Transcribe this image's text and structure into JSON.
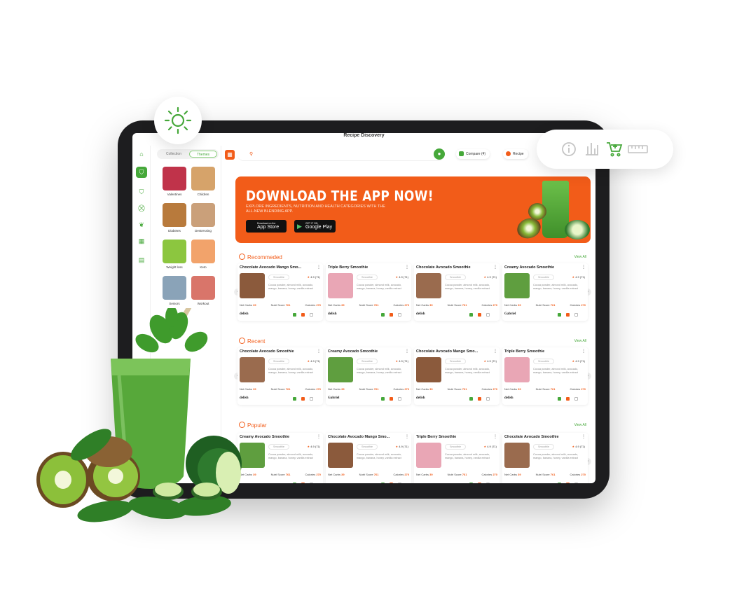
{
  "app": {
    "title": "Recipe Discovery"
  },
  "panel": {
    "tab_collection": "Collection",
    "tab_themes": "Themes",
    "themes": [
      {
        "label": "Valentines",
        "color": "#c0334a"
      },
      {
        "label": "Children",
        "color": "#d6a36a"
      },
      {
        "label": "Diabetes",
        "color": "#b87a3c"
      },
      {
        "label": "Destressing",
        "color": "#caa07a"
      },
      {
        "label": "Weight loss",
        "color": "#8cc63f"
      },
      {
        "label": "Keto",
        "color": "#f2a36b"
      },
      {
        "label": "Seniors",
        "color": "#8aa3b8"
      },
      {
        "label": "Workout",
        "color": "#d9756a"
      }
    ]
  },
  "topbar": {
    "compare_label": "Compare (4)",
    "recipe_label": "Recipe"
  },
  "banner": {
    "heading": "DOWNLOAD THE APP NOW!",
    "subtext": "EXPLORE INGREDIENTS, NUTRITION AND HEALTH CATEGORIES WITH THE ALL-NEW BLENDING APP.",
    "appstore_small": "Download on the",
    "appstore_large": "App Store",
    "googleplay_small": "GET IT ON",
    "googleplay_large": "Google Play"
  },
  "sections": {
    "recommended": {
      "title": "Recommeded",
      "view_all": "View All"
    },
    "recent": {
      "title": "Recent",
      "view_all": "View All"
    },
    "popular": {
      "title": "Popular",
      "view_all": "View All"
    }
  },
  "card_common": {
    "tag": "Smoothie",
    "description": "Cocoa powder, almond milk, avocado, mango, banana, honey, vanilla extract",
    "net_carbs_label": "Net Carbs",
    "nutri_label": "Nutri Score",
    "calories_label": "Calories"
  },
  "cards": {
    "recommended": [
      {
        "title": "Chocolate Avocado Mango Smo...",
        "rating": "4.9 (71)",
        "net_carbs": "39",
        "nutri": "761",
        "calories": "270",
        "brand": "delish",
        "img": "#8b5a3c"
      },
      {
        "title": "Triple Berry Smoothie",
        "rating": "4.9 (71)",
        "net_carbs": "39",
        "nutri": "761",
        "calories": "270",
        "brand": "delish",
        "img": "#e9a6b5"
      },
      {
        "title": "Chocolate Avocado Smoothie",
        "rating": "4.9 (71)",
        "net_carbs": "39",
        "nutri": "761",
        "calories": "270",
        "brand": "delish",
        "img": "#9a6b4e"
      },
      {
        "title": "Creamy Avocado Smoothie",
        "rating": "4.9 (71)",
        "net_carbs": "39",
        "nutri": "761",
        "calories": "270",
        "brand": "Gabriel",
        "img": "#5f9e3f"
      }
    ],
    "recent": [
      {
        "title": "Chocolate Avocado Smoothie",
        "rating": "4.9 (71)",
        "net_carbs": "39",
        "nutri": "761",
        "calories": "270",
        "brand": "delish",
        "img": "#9a6b4e"
      },
      {
        "title": "Creamy Avocado Smoothie",
        "rating": "4.9 (71)",
        "net_carbs": "39",
        "nutri": "761",
        "calories": "270",
        "brand": "Gabriel",
        "img": "#5f9e3f"
      },
      {
        "title": "Chocolate Avocado Mango Smo...",
        "rating": "4.9 (71)",
        "net_carbs": "39",
        "nutri": "761",
        "calories": "270",
        "brand": "delish",
        "img": "#8b5a3c"
      },
      {
        "title": "Triple Berry Smoothie",
        "rating": "4.9 (71)",
        "net_carbs": "39",
        "nutri": "761",
        "calories": "270",
        "brand": "delish",
        "img": "#e9a6b5"
      }
    ],
    "popular": [
      {
        "title": "Creamy Avocado Smoothie",
        "rating": "4.9 (71)",
        "net_carbs": "39",
        "nutri": "761",
        "calories": "270",
        "brand": "",
        "img": "#5f9e3f"
      },
      {
        "title": "Chocolate Avocado Mango Smo...",
        "rating": "4.9 (71)",
        "net_carbs": "39",
        "nutri": "761",
        "calories": "270",
        "brand": "",
        "img": "#8b5a3c"
      },
      {
        "title": "Triple Berry Smoothie",
        "rating": "4.9 (71)",
        "net_carbs": "39",
        "nutri": "761",
        "calories": "270",
        "brand": "",
        "img": "#e9a6b5"
      },
      {
        "title": "Chocolate Avocado Smoothie",
        "rating": "4.9 (71)",
        "net_carbs": "39",
        "nutri": "761",
        "calories": "270",
        "brand": "",
        "img": "#9a6b4e"
      }
    ]
  },
  "icons": {
    "rail": [
      "home-icon",
      "blender-icon",
      "blender2-icon",
      "cart-icon",
      "leaf-icon",
      "grid-icon",
      "calendar-icon"
    ],
    "toolbar": [
      "info-icon",
      "chart-icon",
      "cart-plus-icon",
      "ruler-icon"
    ],
    "sun": "sun-icon"
  },
  "colors": {
    "accent_orange": "#f25c19",
    "accent_green": "#46a83a"
  }
}
